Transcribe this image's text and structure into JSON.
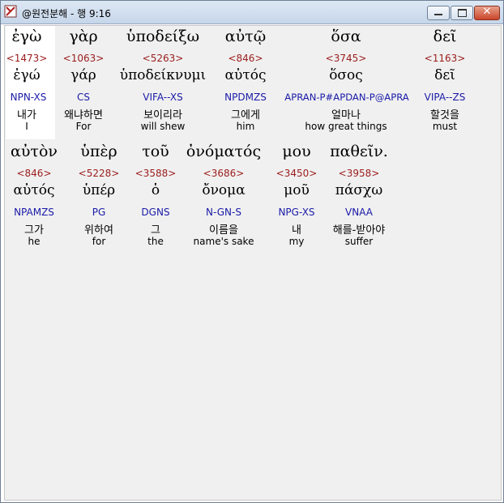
{
  "window": {
    "title": "@원전분해 - 행 9:16"
  },
  "rows": [
    {
      "words": [
        {
          "greek": "ἐγὼ",
          "strongs": "<1473>",
          "lemma": "ἐγώ",
          "parsing": "NPN-XS",
          "korean": "내가",
          "english": "I"
        },
        {
          "greek": "γὰρ",
          "strongs": "<1063>",
          "lemma": "γάρ",
          "parsing": "CS",
          "korean": "왜냐하면",
          "english": "For"
        },
        {
          "greek": "ὑποδείξω",
          "strongs": "<5263>",
          "lemma": "ὑποδείκνυμι",
          "parsing": "VIFA--XS",
          "korean": "보이리라",
          "english": "will shew"
        },
        {
          "greek": "αὐτῷ",
          "strongs": "<846>",
          "lemma": "αὐτός",
          "parsing": "NPDMZS",
          "korean": "그에게",
          "english": "him"
        },
        {
          "greek": "ὅσα",
          "strongs": "<3745>",
          "lemma": "ὅσος",
          "parsing": "APRAN-P#APDAN-P@APRA",
          "korean": "얼마나",
          "english": "how great things"
        },
        {
          "greek": "δεῖ",
          "strongs": "<1163>",
          "lemma": "δεῖ",
          "parsing": "VIPA--ZS",
          "korean": "할것을",
          "english": "must"
        }
      ]
    },
    {
      "words": [
        {
          "greek": "αὐτὸν",
          "strongs": "<846>",
          "lemma": "αὐτός",
          "parsing": "NPAMZS",
          "korean": "그가",
          "english": "he"
        },
        {
          "greek": "ὑπὲρ",
          "strongs": "<5228>",
          "lemma": "ὑπέρ",
          "parsing": "PG",
          "korean": "위하여",
          "english": "for"
        },
        {
          "greek": "τοῦ",
          "strongs": "<3588>",
          "lemma": "ὁ",
          "parsing": "DGNS",
          "korean": "그",
          "english": "the"
        },
        {
          "greek": "ὀνόματός",
          "strongs": "<3686>",
          "lemma": "ὄνομα",
          "parsing": "N-GN-S",
          "korean": "이름을",
          "english": "name's sake"
        },
        {
          "greek": "μου",
          "strongs": "<3450>",
          "lemma": "μοῦ",
          "parsing": "NPG-XS",
          "korean": "내",
          "english": "my"
        },
        {
          "greek": "παθεῖν.",
          "strongs": "<3958>",
          "lemma": "πάσχω",
          "parsing": "VNAA",
          "korean": "해를-받아야",
          "english": "suffer"
        }
      ]
    }
  ]
}
